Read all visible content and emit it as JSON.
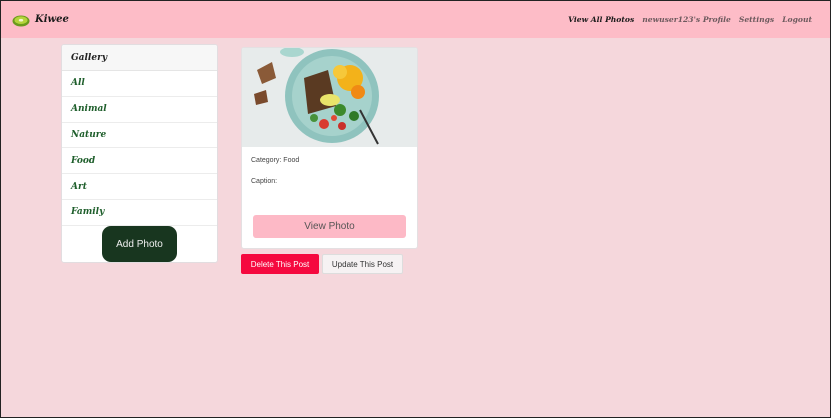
{
  "brand": {
    "name": "Kiwee",
    "logo_icon": "kiwi-slice-icon"
  },
  "nav": {
    "links": [
      "View All Photos",
      "newuser123's Profile",
      "Settings",
      "Logout"
    ]
  },
  "gallery": {
    "header": "Gallery",
    "categories": [
      "All",
      "Animal",
      "Nature",
      "Food",
      "Art",
      "Family"
    ],
    "add_photo_label": "Add Photo"
  },
  "post": {
    "image_alt": "food-salad-photo",
    "category_text": "Category: Food",
    "caption_text": "Caption:",
    "view_photo_label": "View Photo",
    "delete_label": "Delete This Post",
    "update_label": "Update This Post"
  },
  "colors": {
    "page_bg": "#f5d7dc",
    "navbar_bg": "#fdbcc7",
    "category_text": "#1e5e2b",
    "add_photo_bg": "#18361f",
    "view_photo_bg": "#fdb9c6",
    "delete_bg": "#f5093f"
  }
}
